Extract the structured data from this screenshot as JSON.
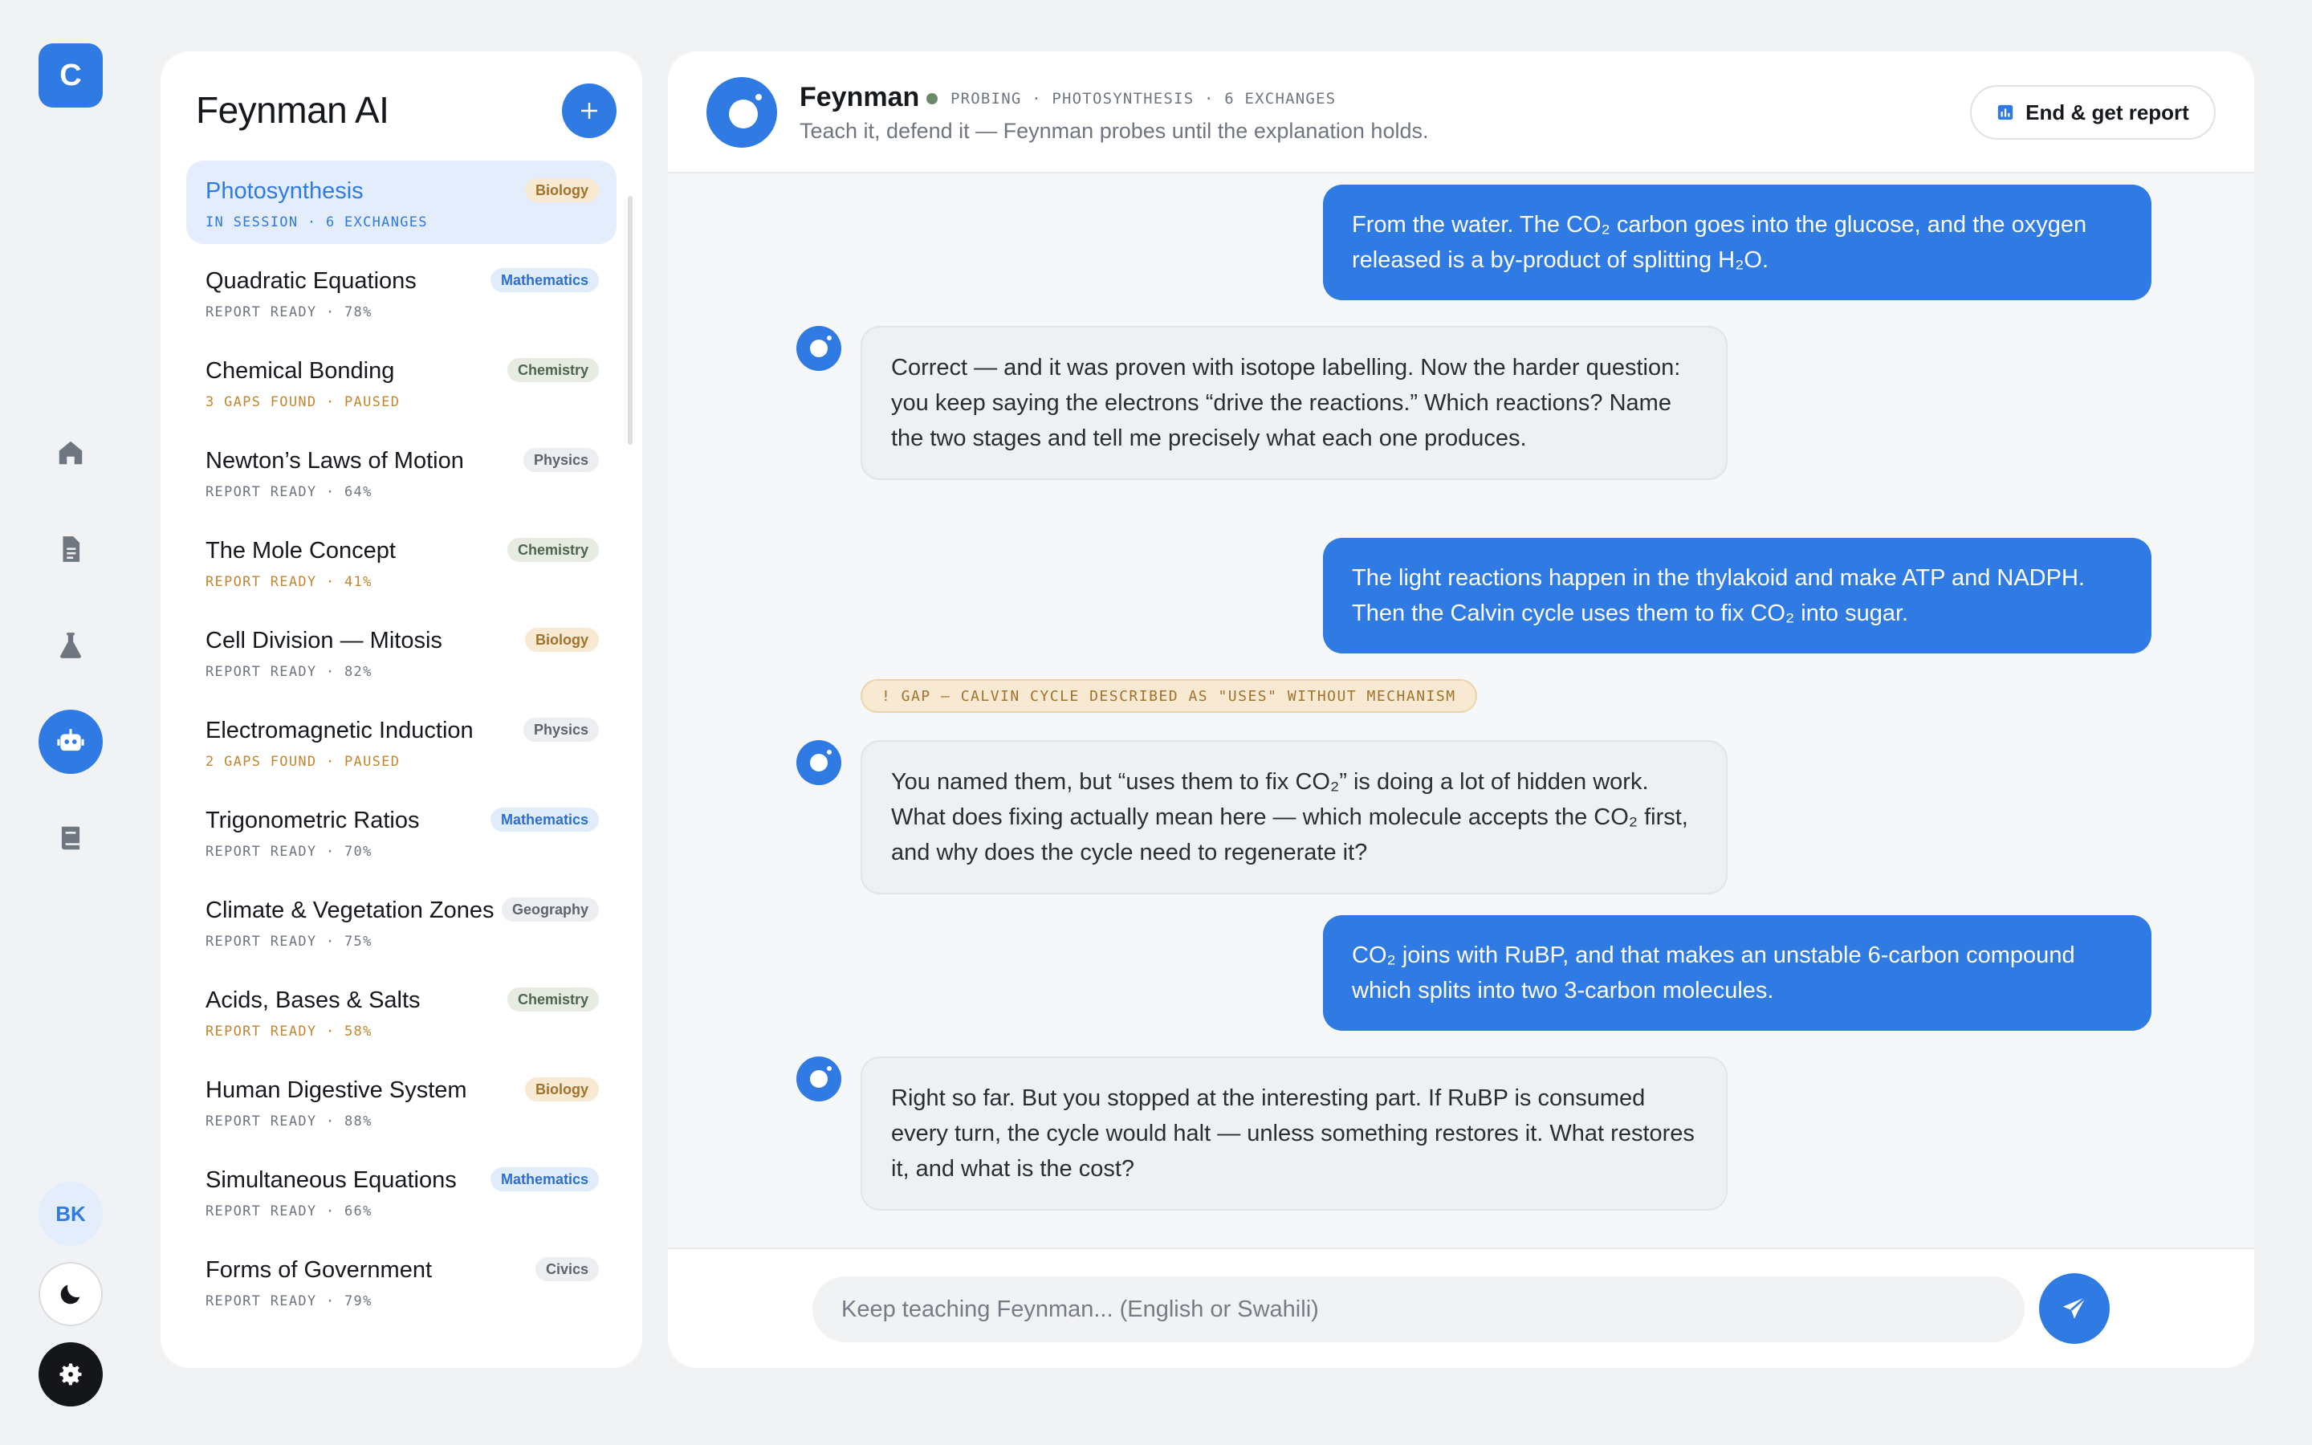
{
  "rail": {
    "logo_letter": "C",
    "avatar_initials": "BK",
    "icons": [
      "home-icon",
      "document-icon",
      "flask-icon",
      "robot-icon",
      "book-icon",
      "moon-icon",
      "gear-icon"
    ],
    "accent": "#2f7ae3"
  },
  "sessions_panel": {
    "title": "Feynman AI",
    "items": [
      {
        "name": "Photosynthesis",
        "tag": "Biology",
        "status": "IN SESSION · 6 EXCHANGES"
      },
      {
        "name": "Quadratic Equations",
        "tag": "Mathematics",
        "status": "REPORT READY · 78%"
      },
      {
        "name": "Chemical Bonding",
        "tag": "Chemistry",
        "status": "3 GAPS FOUND · PAUSED"
      },
      {
        "name": "Newton’s Laws of Motion",
        "tag": "Physics",
        "status": "REPORT READY · 64%"
      },
      {
        "name": "The Mole Concept",
        "tag": "Chemistry",
        "status": "REPORT READY · 41%"
      },
      {
        "name": "Cell Division — Mitosis",
        "tag": "Biology",
        "status": "REPORT READY · 82%"
      },
      {
        "name": "Electromagnetic Induction",
        "tag": "Physics",
        "status": "2 GAPS FOUND · PAUSED"
      },
      {
        "name": "Trigonometric Ratios",
        "tag": "Mathematics",
        "status": "REPORT READY · 70%"
      },
      {
        "name": "Climate & Vegetation Zones",
        "tag": "Geography",
        "status": "REPORT READY · 75%"
      },
      {
        "name": "Acids, Bases & Salts",
        "tag": "Chemistry",
        "status": "REPORT READY · 58%"
      },
      {
        "name": "Human Digestive System",
        "tag": "Biology",
        "status": "REPORT READY · 88%"
      },
      {
        "name": "Simultaneous Equations",
        "tag": "Mathematics",
        "status": "REPORT READY · 66%"
      },
      {
        "name": "Forms of Government",
        "tag": "Civics",
        "status": "REPORT READY · 79%"
      }
    ]
  },
  "chat": {
    "agent_name": "Feynman",
    "agent_meta": "PROBING · PHOTOSYNTHESIS · 6 EXCHANGES",
    "agent_subtitle": "Teach it, defend it — Feynman probes until the explanation holds.",
    "end_button": "End & get report",
    "messages": [
      {
        "role": "user",
        "text": "From the water. The CO₂ carbon goes into the glucose, and the oxygen released is a by-product of splitting H₂O."
      },
      {
        "role": "bot",
        "text": "Correct — and it was proven with isotope labelling. Now the harder question: you keep saying the electrons “drive the reactions.” Which reactions? Name the two stages and tell me precisely what each one produces."
      },
      {
        "role": "user",
        "text": "The light reactions happen in the thylakoid and make ATP and NADPH. Then the Calvin cycle uses them to fix CO₂ into sugar."
      },
      {
        "role": "bot",
        "text": "You named them, but “uses them to fix CO₂” is doing a lot of hidden work. What does fixing actually mean here — which molecule accepts the CO₂ first, and why does the cycle need to regenerate it?"
      },
      {
        "role": "user",
        "text": "CO₂ joins with RuBP, and that makes an unstable 6-carbon compound which splits into two 3-carbon molecules."
      },
      {
        "role": "bot",
        "text": "Right so far. But you stopped at the interesting part. If RuBP is consumed every turn, the cycle would halt — unless something restores it. What restores it, and what is the cost?"
      }
    ],
    "gap_flag": "! GAP — CALVIN CYCLE DESCRIBED AS \"USES\" WITHOUT MECHANISM",
    "composer_placeholder": "Keep teaching Feynman... (English or Swahili)"
  }
}
